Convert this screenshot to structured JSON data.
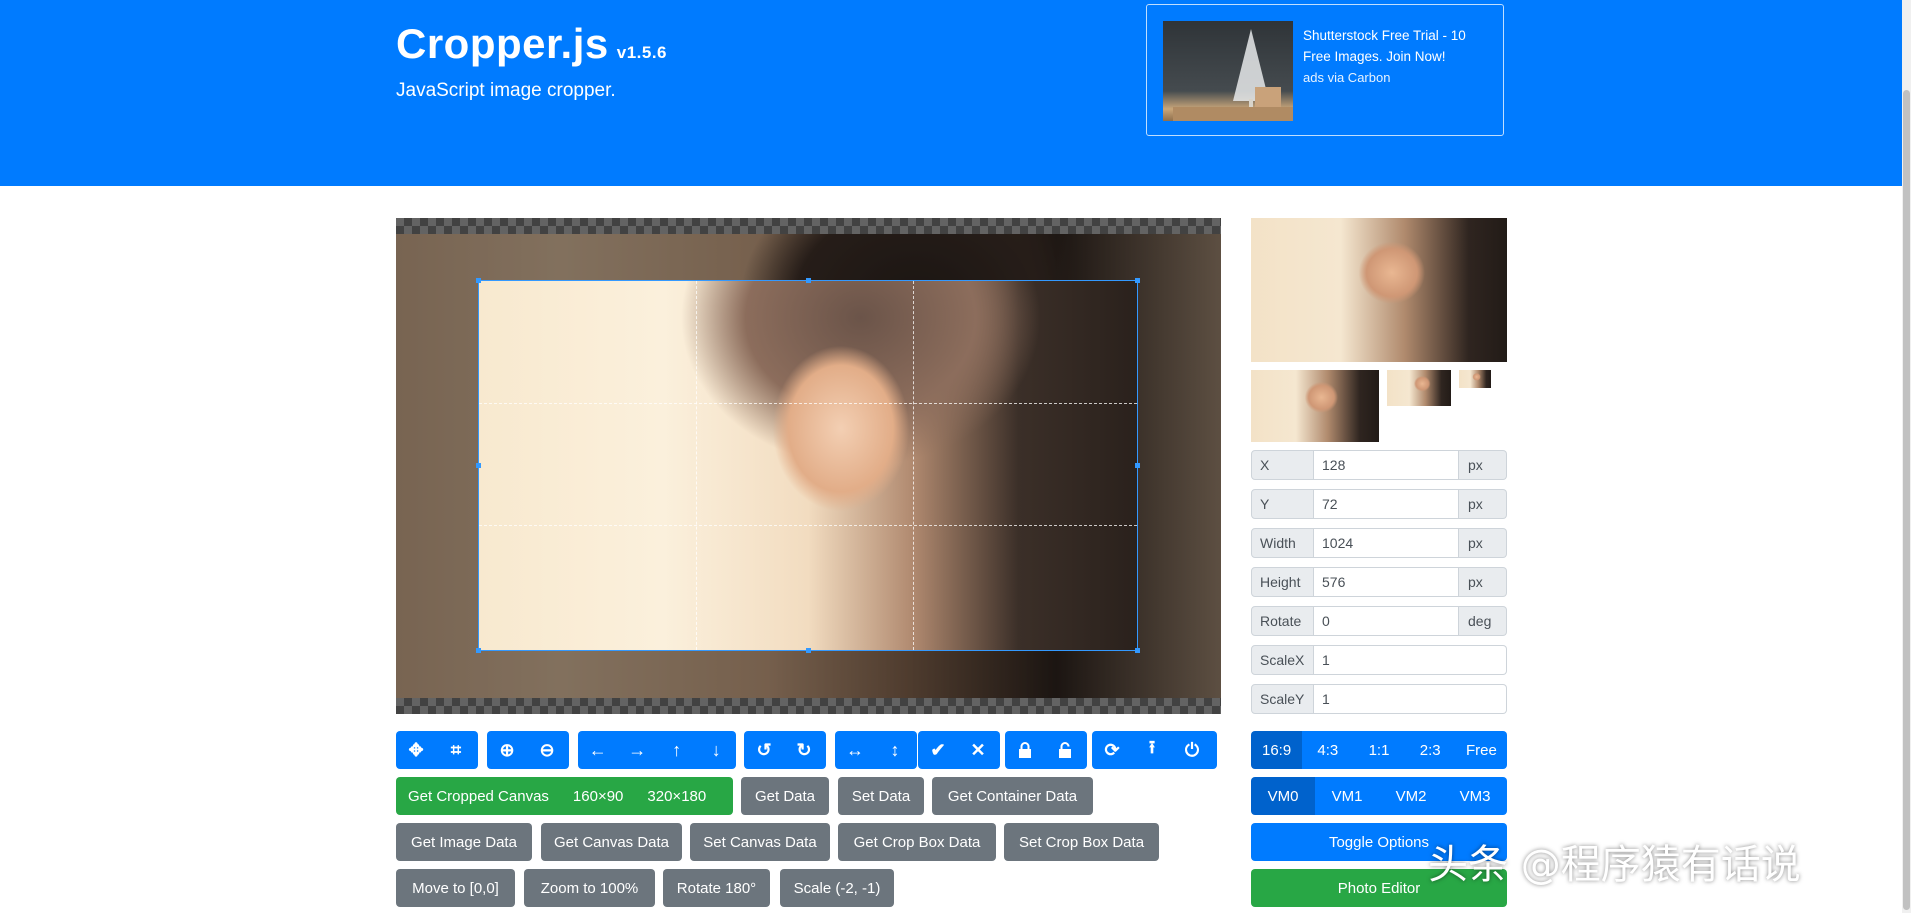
{
  "header": {
    "title": "Cropper.js",
    "version": "v1.5.6",
    "subtitle": "JavaScript image cropper."
  },
  "ad": {
    "text": "Shutterstock Free Trial - 10 Free Images. Join Now!",
    "via": "ads via Carbon"
  },
  "toolbar": {
    "groups": [
      [
        "move-icon",
        "crop-icon"
      ],
      [
        "zoom-in-icon",
        "zoom-out-icon"
      ],
      [
        "arrow-left-icon",
        "arrow-right-icon",
        "arrow-up-icon",
        "arrow-down-icon"
      ],
      [
        "rotate-left-icon",
        "rotate-right-icon"
      ],
      [
        "flip-horizontal-icon",
        "flip-vertical-icon"
      ],
      [
        "check-icon",
        "times-icon"
      ],
      [
        "lock-icon",
        "unlock-icon"
      ],
      [
        "reset-icon",
        "upload-icon",
        "power-icon"
      ]
    ]
  },
  "buttons": {
    "get_cropped_canvas": "Get Cropped Canvas",
    "size_160": "160×90",
    "size_320": "320×180",
    "get_data": "Get Data",
    "set_data": "Set Data",
    "get_container_data": "Get Container Data",
    "get_image_data": "Get Image Data",
    "get_canvas_data": "Get Canvas Data",
    "set_canvas_data": "Set Canvas Data",
    "get_crop_box_data": "Get Crop Box Data",
    "set_crop_box_data": "Set Crop Box Data",
    "move_to": "Move to [0,0]",
    "zoom_to": "Zoom to 100%",
    "rotate_180": "Rotate 180°",
    "scale": "Scale (-2, -1)",
    "toggle_options": "Toggle Options",
    "photo_editor": "Photo Editor"
  },
  "fields": {
    "x": {
      "label": "X",
      "value": "128",
      "unit": "px"
    },
    "y": {
      "label": "Y",
      "value": "72",
      "unit": "px"
    },
    "width": {
      "label": "Width",
      "value": "1024",
      "unit": "px"
    },
    "height": {
      "label": "Height",
      "value": "576",
      "unit": "px"
    },
    "rotate": {
      "label": "Rotate",
      "value": "0",
      "unit": "deg"
    },
    "scalex": {
      "label": "ScaleX",
      "value": "1"
    },
    "scaley": {
      "label": "ScaleY",
      "value": "1"
    }
  },
  "aspect_ratios": [
    "16:9",
    "4:3",
    "1:1",
    "2:3",
    "Free"
  ],
  "view_modes": [
    "VM0",
    "VM1",
    "VM2",
    "VM3"
  ],
  "watermark": "头条 @程序猿有话说"
}
